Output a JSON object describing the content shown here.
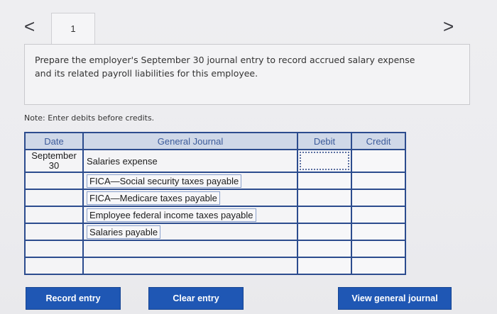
{
  "nav": {
    "prev_icon": "<",
    "next_icon": ">"
  },
  "tab": {
    "number": "1"
  },
  "question": {
    "text": "Prepare the employer's September 30 journal entry to record accrued salary expense and its related payroll liabilities for this employee."
  },
  "note": "Note: Enter debits before credits.",
  "journal": {
    "headers": {
      "date": "Date",
      "account": "General Journal",
      "debit": "Debit",
      "credit": "Credit"
    },
    "date_month": "September",
    "date_day": "30",
    "rows": [
      {
        "account": "Salaries expense",
        "debit": "",
        "credit": ""
      },
      {
        "account": "FICA—Social security taxes payable",
        "debit": "",
        "credit": ""
      },
      {
        "account": "FICA—Medicare taxes payable",
        "debit": "",
        "credit": ""
      },
      {
        "account": "Employee federal income taxes payable",
        "debit": "",
        "credit": ""
      },
      {
        "account": "Salaries payable",
        "debit": "",
        "credit": ""
      },
      {
        "account": "",
        "debit": "",
        "credit": ""
      },
      {
        "account": "",
        "debit": "",
        "credit": ""
      }
    ]
  },
  "buttons": {
    "record": "Record entry",
    "clear": "Clear entry",
    "view": "View general journal"
  },
  "colors": {
    "header_bg": "#cfd8e8",
    "header_text": "#3b5a9a",
    "border": "#2c4c8e",
    "button": "#1f57b4"
  }
}
